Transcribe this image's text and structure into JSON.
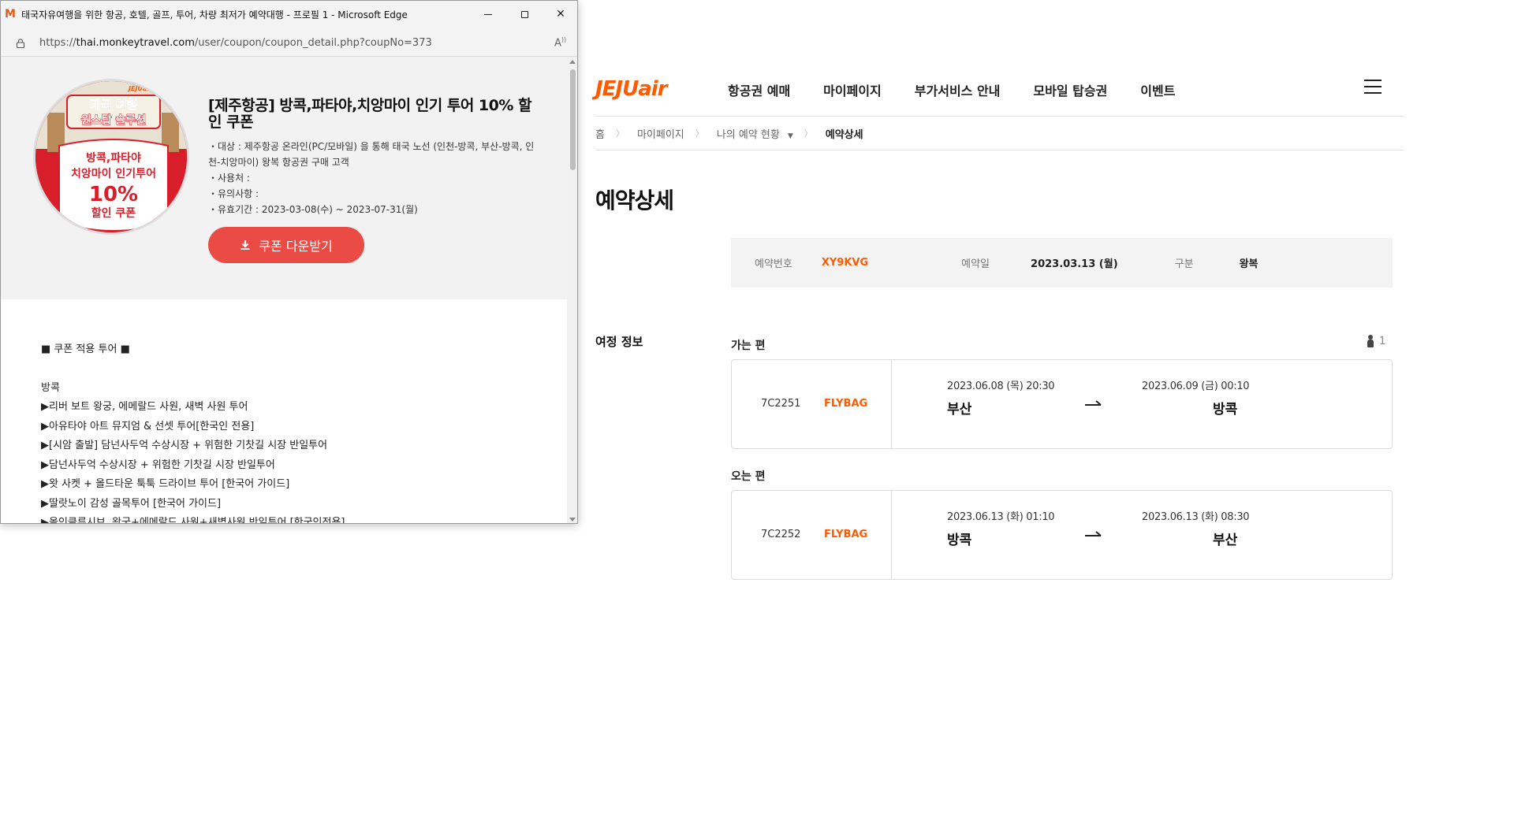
{
  "popup": {
    "window_title": "태국자유여행을 위한 항공, 호텔, 골프, 투어, 차량 최저가 예약대행 - 프로필 1 - Microsoft Edge",
    "url_prefix": "https://",
    "url_host": "thai.monkeytravel.com",
    "url_path": "/user/coupon/coupon_detail.php?coupNo=373",
    "coupon": {
      "image_text_top": "태국 여행",
      "image_text_mid": "원스탑 솔루션",
      "image_text_1": "방콕,파타야",
      "image_text_2": "치앙마이 인기투어",
      "image_text_3": "10%",
      "image_text_4": "할인 쿠폰",
      "image_logo": "JEJUair",
      "title": "[제주항공] 방콕,파타야,치앙마이 인기 투어 10% 할인 쿠폰",
      "target": "・대상 : 제주항공 온라인(PC/모바일) 을 통해 태국 노선 (인천-방콕, 부산-방콕, 인천-치앙마이) 왕복 항공권 구매 고객",
      "usage": "・사용처 :",
      "notes": "・유의사항 :",
      "validity": "・유효기간 : 2023-03-08(수) ~ 2023-07-31(월)",
      "download_label": "쿠폰 다운받기"
    },
    "tours": {
      "heading": "■ 쿠폰 적용 투어 ■",
      "region": "방콕",
      "items": [
        "▶리버 보트 왕궁, 에메랄드 사원, 새벽 사원 투어",
        "▶아유타야 아트 뮤지엄 & 선셋 투어[한국인 전용]",
        "▶[시암 출발] 담넌사두억 수상시장 + 위험한 기찻길 시장 반일투어",
        "▶담넌사두억 수상시장 + 위험한 기찻길 시장 반일투어",
        "▶왓 사켓 + 올드타운 툭툭 드라이브 투어 [한국어 가이드]",
        "▶딸랏노이 감성 골목투어 [한국어 가이드]",
        "▶올인클루시브, 왕궁+에메랄드 사원+새벽사원 반일투어 [한국인전용]"
      ]
    }
  },
  "jeju": {
    "logo_jeju": "JEJU",
    "logo_air": "air",
    "nav": [
      "항공권 예매",
      "마이페이지",
      "부가서비스 안내",
      "모바일 탑승권",
      "이벤트"
    ],
    "breadcrumb": {
      "home": "홈",
      "mypage": "마이페이지",
      "my_reservations": "나의 예약 현황",
      "current": "예약상세"
    },
    "page_title": "예약상세",
    "summary": {
      "res_no_label": "예약번호",
      "res_no": "XY9KVG",
      "res_date_label": "예약일",
      "res_date": "2023.03.13 (월)",
      "type_label": "구분",
      "type": "왕복"
    },
    "itinerary_label": "여정 정보",
    "passenger_count": "1",
    "outbound": {
      "label": "가는 편",
      "flight_no": "7C2251",
      "fare": "FLYBAG",
      "dep_time": "2023.06.08 (목) 20:30",
      "arr_time": "2023.06.09 (금) 00:10",
      "dep_city": "부산",
      "arr_city": "방콕"
    },
    "inbound": {
      "label": "오는 편",
      "flight_no": "7C2252",
      "fare": "FLYBAG",
      "dep_time": "2023.06.13 (화) 01:10",
      "arr_time": "2023.06.13 (화) 08:30",
      "dep_city": "방콕",
      "arr_city": "부산"
    }
  }
}
